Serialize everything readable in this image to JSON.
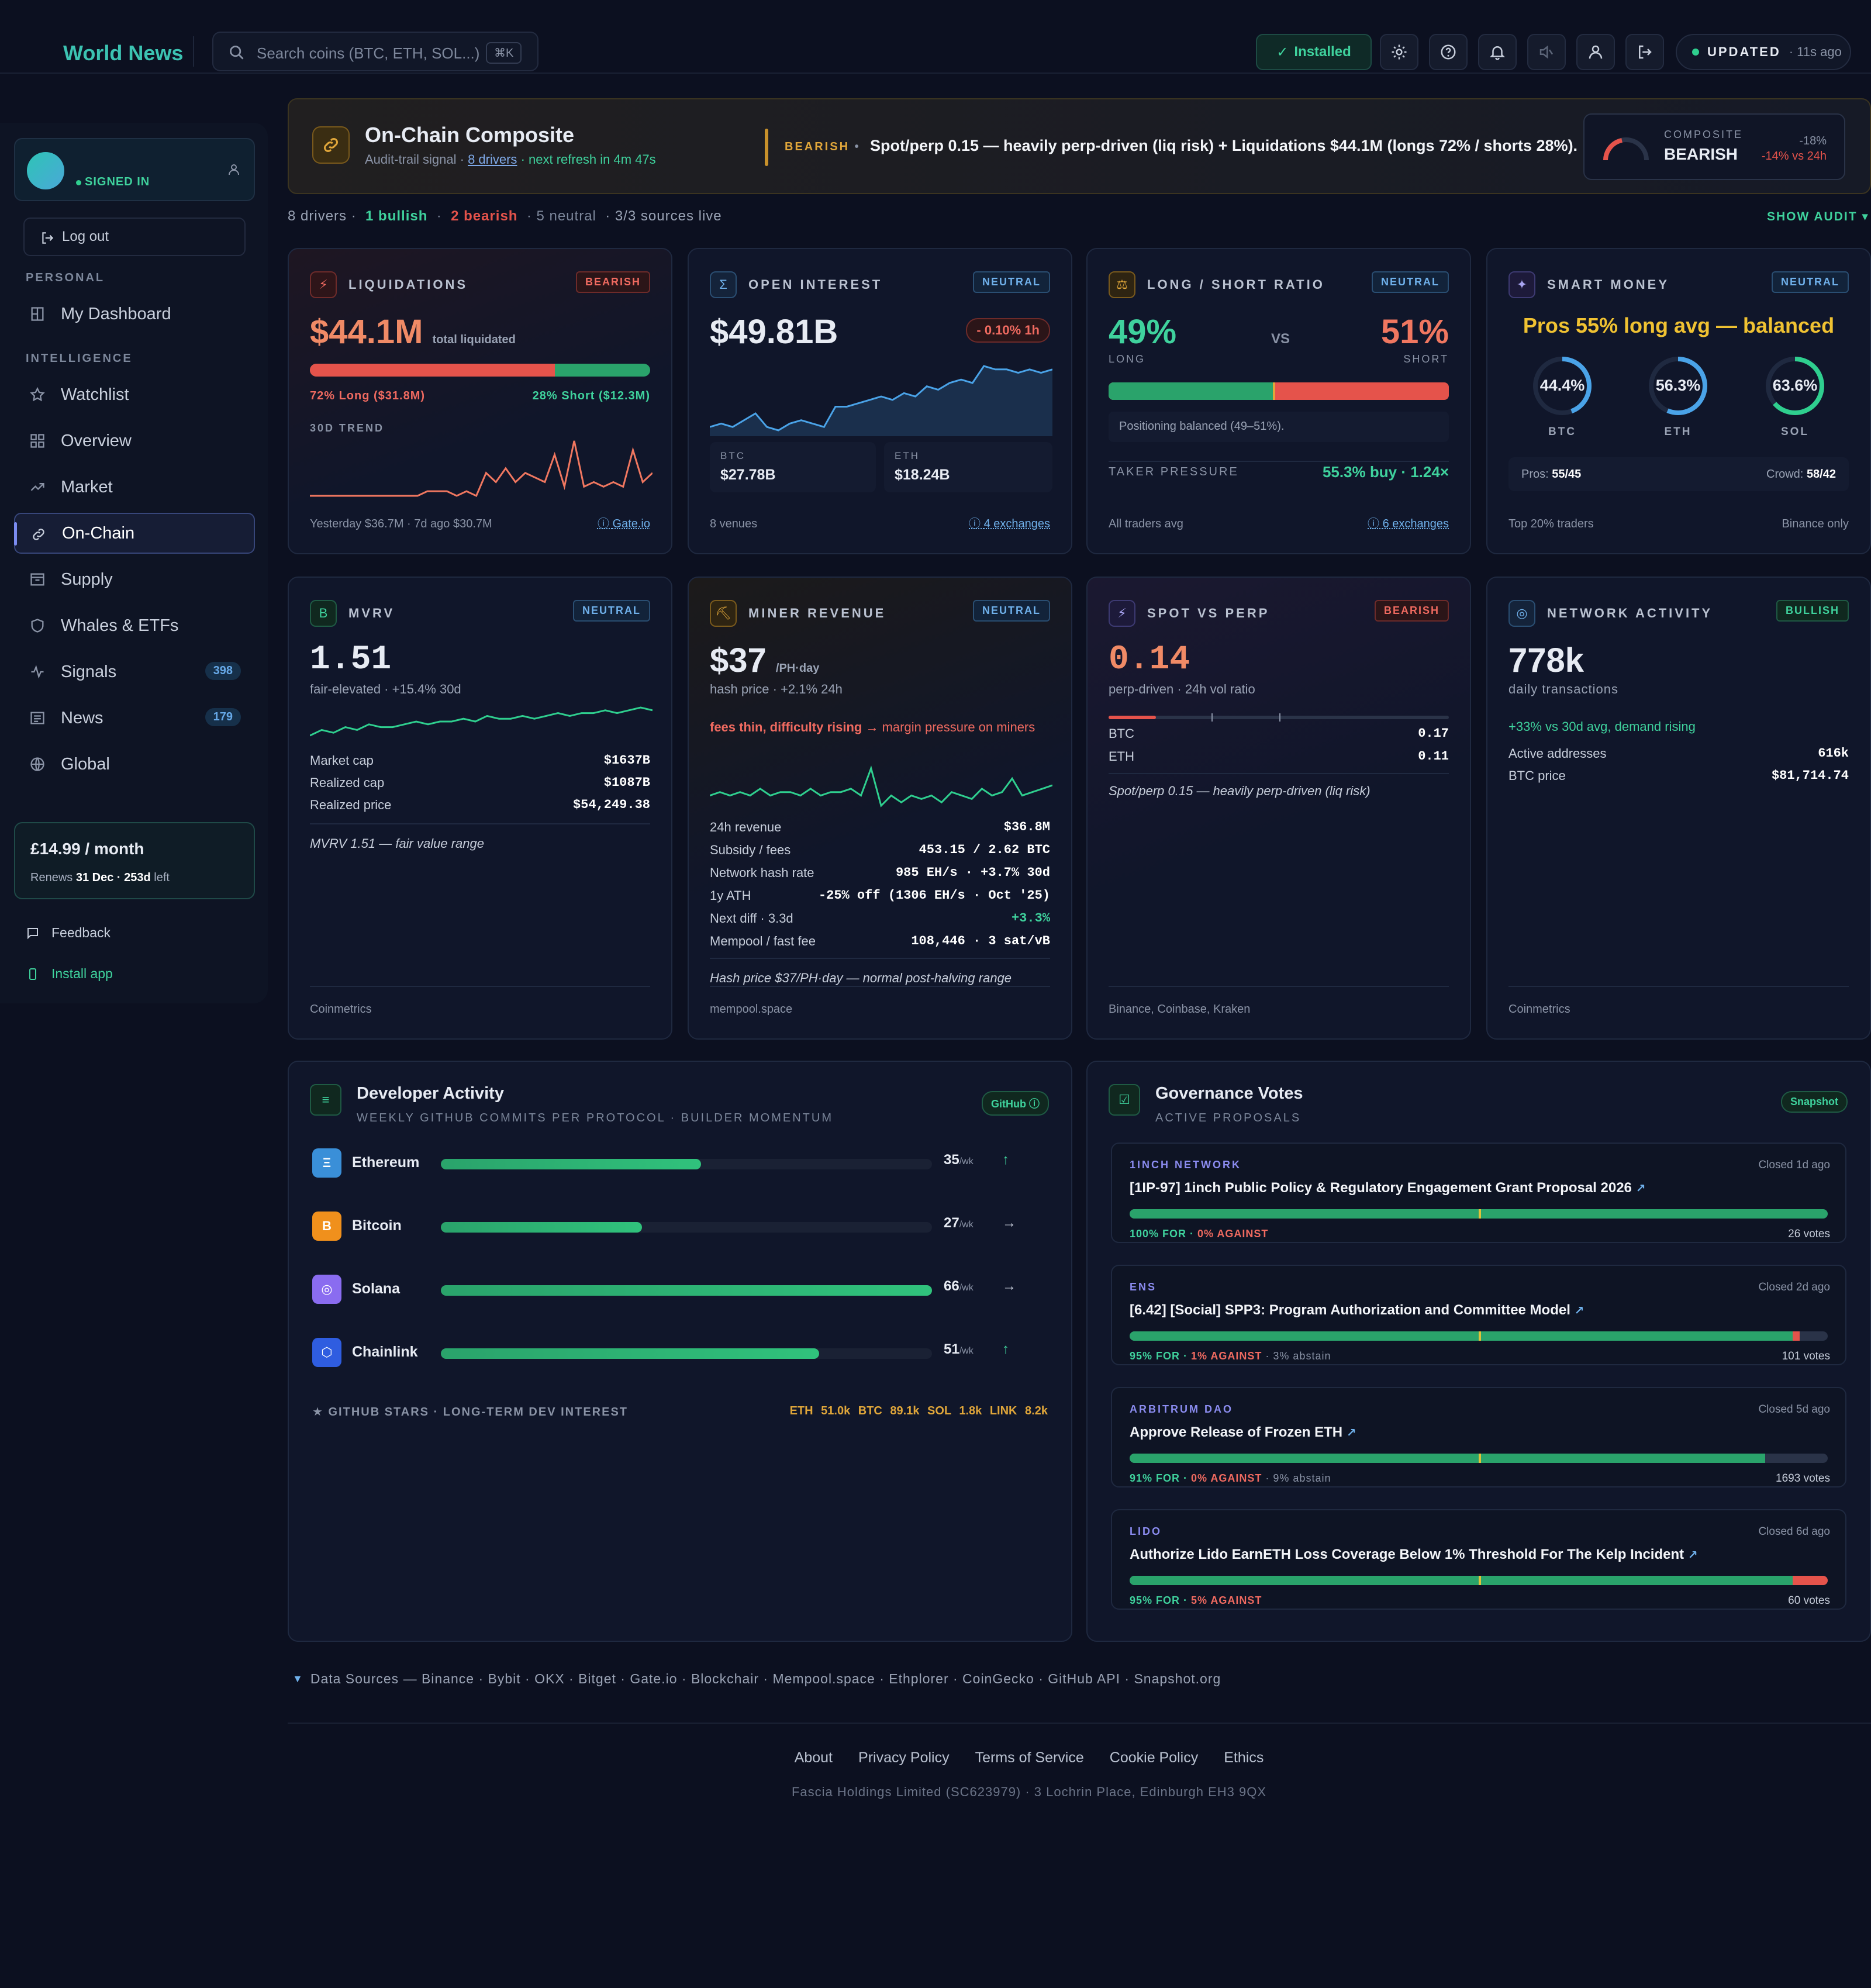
{
  "app": {
    "logo": "World News",
    "search_placeholder": "Search coins (BTC, ETH, SOL...)",
    "search_kbd": "⌘K",
    "installed": "Installed",
    "updated_label": "UPDATED",
    "updated_ago": "· 11s ago"
  },
  "sidebar": {
    "signed_in": "SIGNED IN",
    "logout": "Log out",
    "personal": "PERSONAL",
    "intelligence": "INTELLIGENCE",
    "items": [
      {
        "label": "My Dashboard"
      },
      {
        "label": "Watchlist"
      },
      {
        "label": "Overview"
      },
      {
        "label": "Market"
      },
      {
        "label": "On-Chain"
      },
      {
        "label": "Supply"
      },
      {
        "label": "Whales & ETFs"
      },
      {
        "label": "Signals",
        "badge": "398"
      },
      {
        "label": "News",
        "badge": "179"
      },
      {
        "label": "Global"
      }
    ],
    "plan_price": "£14.99 / month",
    "plan_renew": "Renews",
    "plan_date": "31 Dec · 253d",
    "plan_left": "left",
    "feedback": "Feedback",
    "install": "Install app"
  },
  "composite": {
    "title": "On-Chain Composite",
    "sub_a": "Audit-trail signal ·",
    "sub_drivers": "8 drivers",
    "sub_refresh": "· next refresh in 4m 47s",
    "tag": "BEARISH",
    "message": "Spot/perp 0.15 — heavily perp-driven (liq risk) + Liquidations $44.1M (longs 72% / shorts 28%).",
    "box_label": "COMPOSITE",
    "box_value": "BEARISH",
    "box_score": "-18%",
    "box_vs": "-14% vs 24h"
  },
  "summary": {
    "drivers": "8 drivers ·",
    "bullish": "1 bullish",
    "sep": "·",
    "bearish": "2 bearish",
    "neutral": "· 5 neutral",
    "live": "· 3/3 sources live",
    "audit": "SHOW AUDIT ▾"
  },
  "cards": {
    "liq": {
      "label": "LIQUIDATIONS",
      "tag": "BEARISH",
      "value": "$44.1M",
      "unit": "total liquidated",
      "long": "72% Long ($31.8M)",
      "short": "28% Short ($12.3M)",
      "trend": "30D TREND",
      "foot": "Yesterday $36.7M · 7d ago $30.7M",
      "src": "Gate.io",
      "long_pct": 72,
      "trend_data": [
        2,
        2,
        2,
        2,
        2,
        2,
        2,
        2,
        2,
        2,
        2,
        2,
        3,
        3,
        3,
        2,
        3,
        2,
        7,
        5,
        8,
        5,
        7,
        6,
        5,
        11,
        4,
        14,
        4,
        5,
        4,
        5,
        4,
        12,
        5,
        7
      ]
    },
    "oi": {
      "label": "OPEN INTEREST",
      "tag": "NEUTRAL",
      "value": "$49.81B",
      "change": "- 0.10% 1h",
      "btc_l": "BTC",
      "btc_v": "$27.78B",
      "eth_l": "ETH",
      "eth_v": "$18.24B",
      "foot": "8 venues",
      "src": "4 exchanges",
      "spark": [
        4,
        5,
        4,
        6,
        8,
        4,
        3,
        5,
        6,
        5,
        4,
        10,
        10,
        11,
        12,
        13,
        12,
        14,
        13,
        16,
        15,
        17,
        18,
        17,
        22,
        21,
        21,
        20,
        21,
        20,
        21
      ]
    },
    "ls": {
      "label": "LONG / SHORT RATIO",
      "tag": "NEUTRAL",
      "long": "49%",
      "vs": "VS",
      "short": "51%",
      "long_l": "LONG",
      "short_l": "SHORT",
      "long_pct": 49,
      "note": "Positioning balanced (49–51%).",
      "taker": "TAKER PRESSURE",
      "taker_v": "55.3% buy · 1.24×",
      "foot": "All traders avg",
      "src": "6 exchanges"
    },
    "sm": {
      "label": "SMART MONEY",
      "tag": "NEUTRAL",
      "headline": "Pros 55% long avg — balanced",
      "rings": [
        {
          "v": "44.4%",
          "l": "BTC",
          "pct": 44.4,
          "c": "#4aa3e8"
        },
        {
          "v": "56.3%",
          "l": "ETH",
          "pct": 56.3,
          "c": "#4aa3e8"
        },
        {
          "v": "63.6%",
          "l": "SOL",
          "pct": 63.6,
          "c": "#2fcf8f"
        }
      ],
      "pros_l": "Pros:",
      "pros_v": "55/45",
      "crowd_l": "Crowd:",
      "crowd_v": "58/42",
      "foot": "Top 20% traders",
      "foot_r": "Binance only"
    },
    "mvrv": {
      "label": "MVRV",
      "tag": "NEUTRAL",
      "value": "1.51",
      "sub": "fair-elevated · +15.4% 30d",
      "rows": [
        {
          "k": "Market cap",
          "v": "$1637B"
        },
        {
          "k": "Realized cap",
          "v": "$1087B"
        },
        {
          "k": "Realized price",
          "v": "$54,249.38"
        }
      ],
      "note": "MVRV 1.51 — fair value range",
      "foot": "Coinmetrics",
      "spark": [
        3,
        5,
        4,
        6,
        5,
        7,
        6,
        6,
        7,
        8,
        7,
        8,
        8,
        9,
        8,
        10,
        9,
        9,
        10,
        9,
        10,
        11,
        10,
        11,
        11,
        12,
        11,
        12,
        13,
        12
      ]
    },
    "miner": {
      "label": "MINER REVENUE",
      "tag": "NEUTRAL",
      "value": "$37",
      "unit": "/PH·day",
      "sub": "hash price · +2.1% 24h",
      "alert": "fees thin, difficulty rising",
      "alert2": "→ margin pressure on miners",
      "rows": [
        {
          "k": "24h revenue",
          "v": "$36.8M"
        },
        {
          "k": "Subsidy / fees",
          "v": "453.15 / 2.62 BTC"
        },
        {
          "k": "Network hash rate",
          "v": "985 EH/s · +3.7% 30d"
        },
        {
          "k": "1y ATH",
          "v": "-25% off (1306 EH/s · Oct '25)"
        },
        {
          "k": "Next diff · 3.3d",
          "v": "+3.3%"
        },
        {
          "k": "Mempool / fast fee",
          "v": "108,446 · 3 sat/vB"
        }
      ],
      "note": "Hash price $37/PH·day — normal post-halving range",
      "foot": "mempool.space",
      "spark": [
        6,
        7,
        6,
        7,
        6,
        8,
        6,
        7,
        7,
        6,
        8,
        6,
        7,
        7,
        8,
        6,
        14,
        3,
        6,
        4,
        6,
        5,
        6,
        4,
        7,
        6,
        5,
        8,
        6,
        7,
        11,
        6,
        7,
        8,
        9
      ]
    },
    "svp": {
      "label": "SPOT VS PERP",
      "tag": "BEARISH",
      "value": "0.14",
      "sub": "perp-driven · 24h vol ratio",
      "rows": [
        {
          "k": "BTC",
          "v": "0.17"
        },
        {
          "k": "ETH",
          "v": "0.11"
        }
      ],
      "note": "Spot/perp 0.15 — heavily perp-driven (liq risk)",
      "foot": "Binance, Coinbase, Kraken",
      "ratio": 0.14
    },
    "na": {
      "label": "NETWORK ACTIVITY",
      "tag": "BULLISH",
      "value": "778k",
      "sub": "daily transactions",
      "alert": "+33% vs 30d avg, demand rising",
      "rows": [
        {
          "k": "Active addresses",
          "v": "616k"
        },
        {
          "k": "BTC price",
          "v": "$81,714.74"
        }
      ],
      "foot": "Coinmetrics"
    }
  },
  "dev": {
    "title": "Developer Activity",
    "subtitle": "WEEKLY GITHUB COMMITS PER PROTOCOL · BUILDER MOMENTUM",
    "badge": "GitHub ⓘ",
    "unit": "/wk",
    "items": [
      {
        "name": "Ethereum",
        "value": "35",
        "pct": 53,
        "arrow": "↑",
        "icon": "Ξ",
        "color": "#3a8fd8",
        "acolor": "#3fd29d"
      },
      {
        "name": "Bitcoin",
        "value": "27",
        "pct": 41,
        "arrow": "→",
        "icon": "B",
        "color": "#f0901c",
        "acolor": "#c7cedb"
      },
      {
        "name": "Solana",
        "value": "66",
        "pct": 100,
        "arrow": "→",
        "icon": "◎",
        "color": "#8a6cf0",
        "acolor": "#c7cedb"
      },
      {
        "name": "Chainlink",
        "value": "51",
        "pct": 77,
        "arrow": "↑",
        "icon": "⬡",
        "color": "#2f5de0",
        "acolor": "#3fd29d"
      }
    ],
    "stars_label": "★ GITHUB STARS · LONG-TERM DEV INTEREST",
    "stars": [
      "ETH 51.0k",
      "BTC 89.1k",
      "SOL 1.8k",
      "LINK 8.2k"
    ]
  },
  "gov": {
    "title": "Governance Votes",
    "subtitle": "ACTIVE PROPOSALS",
    "badge": "Snapshot",
    "items": [
      {
        "org": "1INCH NETWORK",
        "closed": "Closed 1d ago",
        "title": "[1IP-97] 1inch Public Policy & Regulatory Engagement Grant Proposal 2026",
        "for": "100% FOR",
        "against": "0% AGAINST",
        "abstain": "",
        "votes": "26 votes",
        "for_pct": 100,
        "against_pct": 0
      },
      {
        "org": "ENS",
        "closed": "Closed 2d ago",
        "title": "[6.42] [Social] SPP3: Program Authorization and Committee Model",
        "for": "95% FOR",
        "against": "1% AGAINST",
        "abstain": "· 3% abstain",
        "votes": "101 votes",
        "for_pct": 95,
        "against_pct": 1
      },
      {
        "org": "ARBITRUM DAO",
        "closed": "Closed 5d ago",
        "title": "Approve Release of Frozen ETH",
        "for": "91% FOR",
        "against": "0% AGAINST",
        "abstain": "· 9% abstain",
        "votes": "1693 votes",
        "for_pct": 91,
        "against_pct": 0
      },
      {
        "org": "LIDO",
        "closed": "Closed 6d ago",
        "title": "Authorize Lido EarnETH Loss Coverage Below 1% Threshold For The Kelp Incident",
        "for": "95% FOR",
        "against": "5% AGAINST",
        "abstain": "",
        "votes": "60 votes",
        "for_pct": 95,
        "against_pct": 5
      }
    ]
  },
  "footer": {
    "sources": "Data Sources — Binance · Bybit · OKX · Bitget · Gate.io · Blockchair · Mempool.space · Ethplorer · CoinGecko · GitHub API · Snapshot.org",
    "links": [
      "About",
      "Privacy Policy",
      "Terms of Service",
      "Cookie Policy",
      "Ethics"
    ],
    "address": "Fascia Holdings Limited (SC623979) · 3 Lochrin Place, Edinburgh EH3 9QX"
  }
}
